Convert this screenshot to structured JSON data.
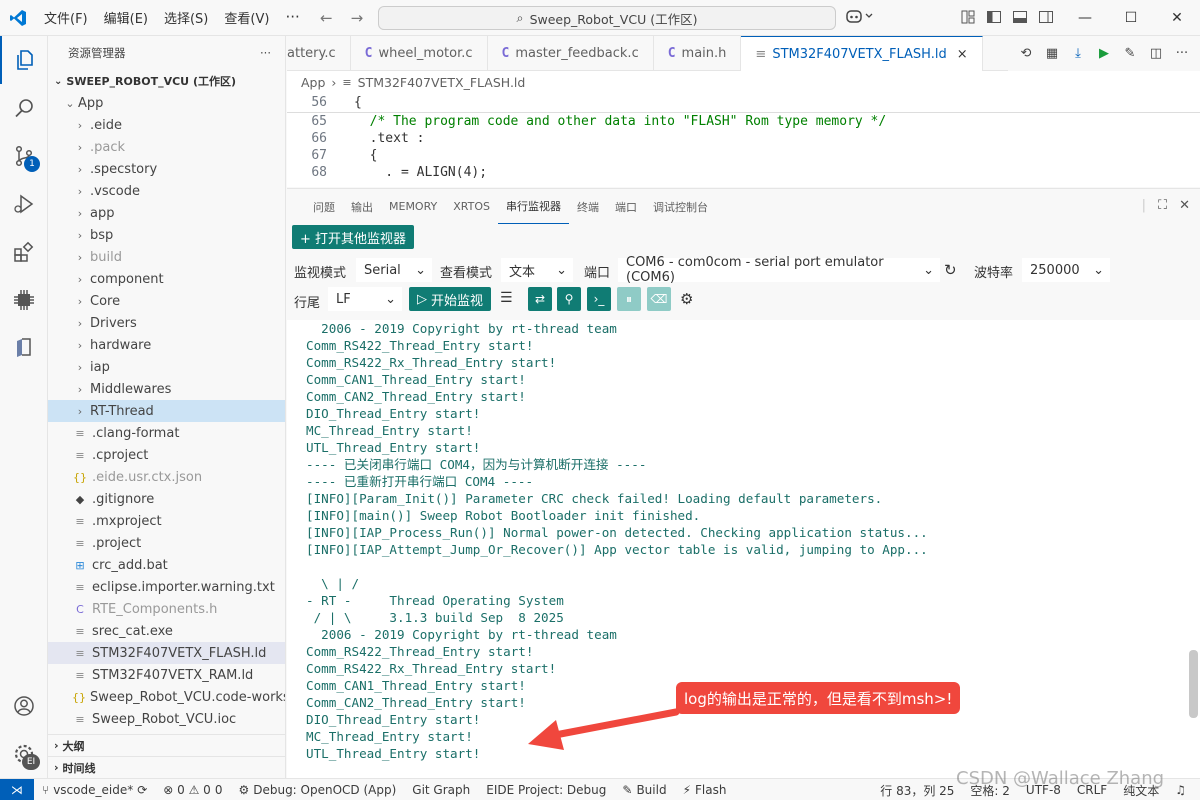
{
  "titlebar": {
    "menu": [
      "文件(F)",
      "编辑(E)",
      "选择(S)",
      "查看(V)"
    ],
    "more": "···",
    "search": "Sweep_Robot_VCU (工作区)"
  },
  "activity": {
    "scm_badge": "1",
    "settings_badge": "EI"
  },
  "sidebar": {
    "title": "资源管理器",
    "more": "···",
    "workspace": "SWEEP_ROBOT_VCU (工作区)",
    "root": "App",
    "items": [
      {
        "label": ".eide",
        "type": "folder",
        "dim": false
      },
      {
        "label": ".pack",
        "type": "folder",
        "dim": true
      },
      {
        "label": ".specstory",
        "type": "folder",
        "dim": false
      },
      {
        "label": ".vscode",
        "type": "folder",
        "dim": false
      },
      {
        "label": "app",
        "type": "folder",
        "dim": false
      },
      {
        "label": "bsp",
        "type": "folder",
        "dim": false
      },
      {
        "label": "build",
        "type": "folder",
        "dim": true
      },
      {
        "label": "component",
        "type": "folder",
        "dim": false
      },
      {
        "label": "Core",
        "type": "folder",
        "dim": false
      },
      {
        "label": "Drivers",
        "type": "folder",
        "dim": false
      },
      {
        "label": "hardware",
        "type": "folder",
        "dim": false
      },
      {
        "label": "iap",
        "type": "folder",
        "dim": false
      },
      {
        "label": "Middlewares",
        "type": "folder",
        "dim": false
      },
      {
        "label": "RT-Thread",
        "type": "folder",
        "dim": false,
        "selected": true
      },
      {
        "label": ".clang-format",
        "type": "lines",
        "dim": false
      },
      {
        "label": ".cproject",
        "type": "lines",
        "dim": false
      },
      {
        "label": ".eide.usr.ctx.json",
        "type": "json",
        "dim": true
      },
      {
        "label": ".gitignore",
        "type": "git",
        "dim": false
      },
      {
        "label": ".mxproject",
        "type": "lines",
        "dim": false
      },
      {
        "label": ".project",
        "type": "lines",
        "dim": false
      },
      {
        "label": "crc_add.bat",
        "type": "win",
        "dim": false
      },
      {
        "label": "eclipse.importer.warning.txt",
        "type": "lines",
        "dim": false
      },
      {
        "label": "RTE_Components.h",
        "type": "c",
        "dim": true
      },
      {
        "label": "srec_cat.exe",
        "type": "lines",
        "dim": false
      },
      {
        "label": "STM32F407VETX_FLASH.ld",
        "type": "lines",
        "dim": false,
        "active": true
      },
      {
        "label": "STM32F407VETX_RAM.ld",
        "type": "lines",
        "dim": false
      },
      {
        "label": "Sweep_Robot_VCU.code-worksp...",
        "type": "json",
        "dim": false
      },
      {
        "label": "Sweep_Robot_VCU.ioc",
        "type": "lines",
        "dim": false
      }
    ],
    "outline": "大纲",
    "timeline": "时间线"
  },
  "tabs": [
    {
      "label": "attery.c",
      "icon": "",
      "active": false
    },
    {
      "label": "wheel_motor.c",
      "icon": "C",
      "active": false
    },
    {
      "label": "master_feedback.c",
      "icon": "C",
      "active": false
    },
    {
      "label": "main.h",
      "icon": "C",
      "active": false
    },
    {
      "label": "STM32F407VETX_FLASH.ld",
      "icon": "",
      "active": true
    }
  ],
  "breadcrumb": {
    "root": "App",
    "file": "STM32F407VETX_FLASH.ld"
  },
  "code": [
    {
      "ln": "56",
      "text": "{",
      "comment": false
    },
    {
      "ln": "65",
      "text": "  /* The program code and other data into \"FLASH\" Rom type memory */",
      "comment": true
    },
    {
      "ln": "66",
      "text": "  .text :",
      "comment": false
    },
    {
      "ln": "67",
      "text": "  {",
      "comment": false
    },
    {
      "ln": "68",
      "text": "    . = ALIGN(4);",
      "comment": false
    }
  ],
  "panel": {
    "tabs": [
      "问题",
      "输出",
      "MEMORY",
      "XRTOS",
      "串行监视器",
      "终端",
      "端口",
      "调试控制台"
    ],
    "active_tab": "串行监视器",
    "open_other": "+ 打开其他监视器",
    "monitor_mode_label": "监视模式",
    "monitor_mode": "Serial",
    "view_mode_label": "查看模式",
    "view_mode": "文本",
    "port_label": "端口",
    "port": "COM6 - com0com - serial port emulator (COM6)",
    "baud_label": "波特率",
    "baud": "250000",
    "line_end_label": "行尾",
    "line_end": "LF",
    "start_button": "开始监视"
  },
  "terminal": [
    "  2006 - 2019 Copyright by rt-thread team",
    "Comm_RS422_Thread_Entry start!",
    "Comm_RS422_Rx_Thread_Entry start!",
    "Comm_CAN1_Thread_Entry start!",
    "Comm_CAN2_Thread_Entry start!",
    "DIO_Thread_Entry start!",
    "MC_Thread_Entry start!",
    "UTL_Thread_Entry start!",
    "---- 已关闭串行端口 COM4，因为与计算机断开连接 ----",
    "---- 已重新打开串行端口 COM4 ----",
    "[INFO][Param_Init()] Parameter CRC check failed! Loading default parameters.",
    "[INFO][main()] Sweep Robot Bootloader init finished.",
    "[INFO][IAP_Process_Run()] Normal power-on detected. Checking application status...",
    "[INFO][IAP_Attempt_Jump_Or_Recover()] App vector table is valid, jumping to App...",
    "",
    "  \\ | /",
    "- RT -     Thread Operating System",
    " / | \\     3.1.3 build Sep  8 2025",
    "  2006 - 2019 Copyright by rt-thread team",
    "Comm_RS422_Thread_Entry start!",
    "Comm_RS422_Rx_Thread_Entry start!",
    "Comm_CAN1_Thread_Entry start!",
    "Comm_CAN2_Thread_Entry start!",
    "DIO_Thread_Entry start!",
    "MC_Thread_Entry start!",
    "UTL_Thread_Entry start!"
  ],
  "callout": "log的输出是正常的，但是看不到msh>!",
  "status": {
    "branch": "vscode_eide*",
    "problems": "⊗ 0 ⚠ 0",
    "problems_extra": "0",
    "debug": "Debug: OpenOCD (App)",
    "git_graph": "Git Graph",
    "eide_project": "EIDE Project: Debug",
    "build": "Build",
    "flash": "Flash",
    "position": "行 83，列 25",
    "spaces": "空格: 2",
    "encoding": "UTF-8",
    "eol": "CRLF",
    "lang": "纯文本"
  },
  "watermark": "CSDN @Wallace Zhang",
  "colors": {
    "accent": "#005fb8",
    "teal": "#107c74",
    "callout": "#f0473d",
    "terminal_text": "#1b6f68"
  }
}
